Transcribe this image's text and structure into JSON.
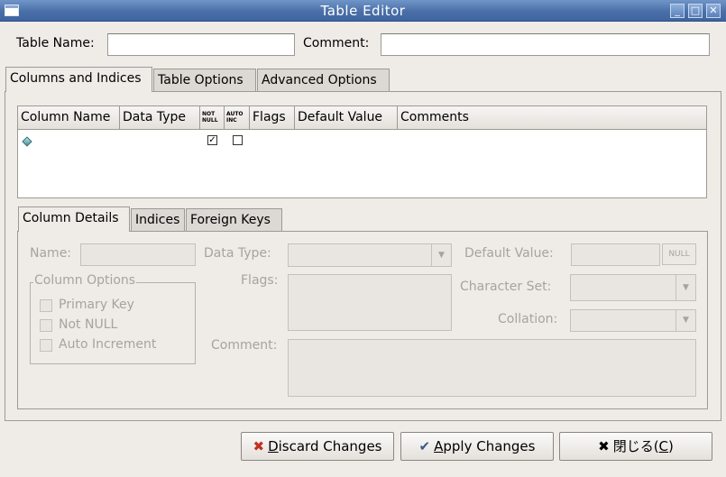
{
  "window": {
    "title": "Table Editor",
    "controls": {
      "minimize": "_",
      "maximize": "□",
      "close": "✕"
    }
  },
  "name_row": {
    "table_name_label": "Table Name:",
    "table_name_value": "",
    "comment_label": "Comment:",
    "comment_value": ""
  },
  "tabs": [
    {
      "label": "Columns and Indices",
      "active": true
    },
    {
      "label": "Table Options",
      "active": false
    },
    {
      "label": "Advanced Options",
      "active": false
    }
  ],
  "grid": {
    "headers": [
      "Column Name",
      "Data Type",
      "NOT NULL",
      "AUTO INC",
      "Flags",
      "Default Value",
      "Comments"
    ],
    "rows": [
      {
        "icon": "key-diamond-icon",
        "column_name": "",
        "data_type": "",
        "not_null": true,
        "auto_inc": false,
        "flags": "",
        "default_value": "",
        "comments": ""
      }
    ]
  },
  "sub_tabs": [
    {
      "label": "Column Details",
      "active": true
    },
    {
      "label": "Indices",
      "active": false
    },
    {
      "label": "Foreign Keys",
      "active": false
    }
  ],
  "details": {
    "name_label": "Name:",
    "data_type_label": "Data Type:",
    "default_value_label": "Default Value:",
    "null_button": "NULL",
    "column_options_title": "Column Options",
    "primary_key": "Primary Key",
    "not_null": "Not NULL",
    "auto_increment": "Auto Increment",
    "flags_label": "Flags:",
    "character_set_label": "Character Set:",
    "collation_label": "Collation:",
    "comment_label": "Comment:"
  },
  "buttons": {
    "discard_mn": "D",
    "discard_rest": "iscard Changes",
    "apply_mn": "A",
    "apply_rest": "pply Changes",
    "close_prefix": "閉じる(",
    "close_mn": "C",
    "close_suffix": ")"
  },
  "colors": {
    "titlebar": "#4a6fa8",
    "background": "#efebe7",
    "disabled_text": "#a7a39e"
  }
}
